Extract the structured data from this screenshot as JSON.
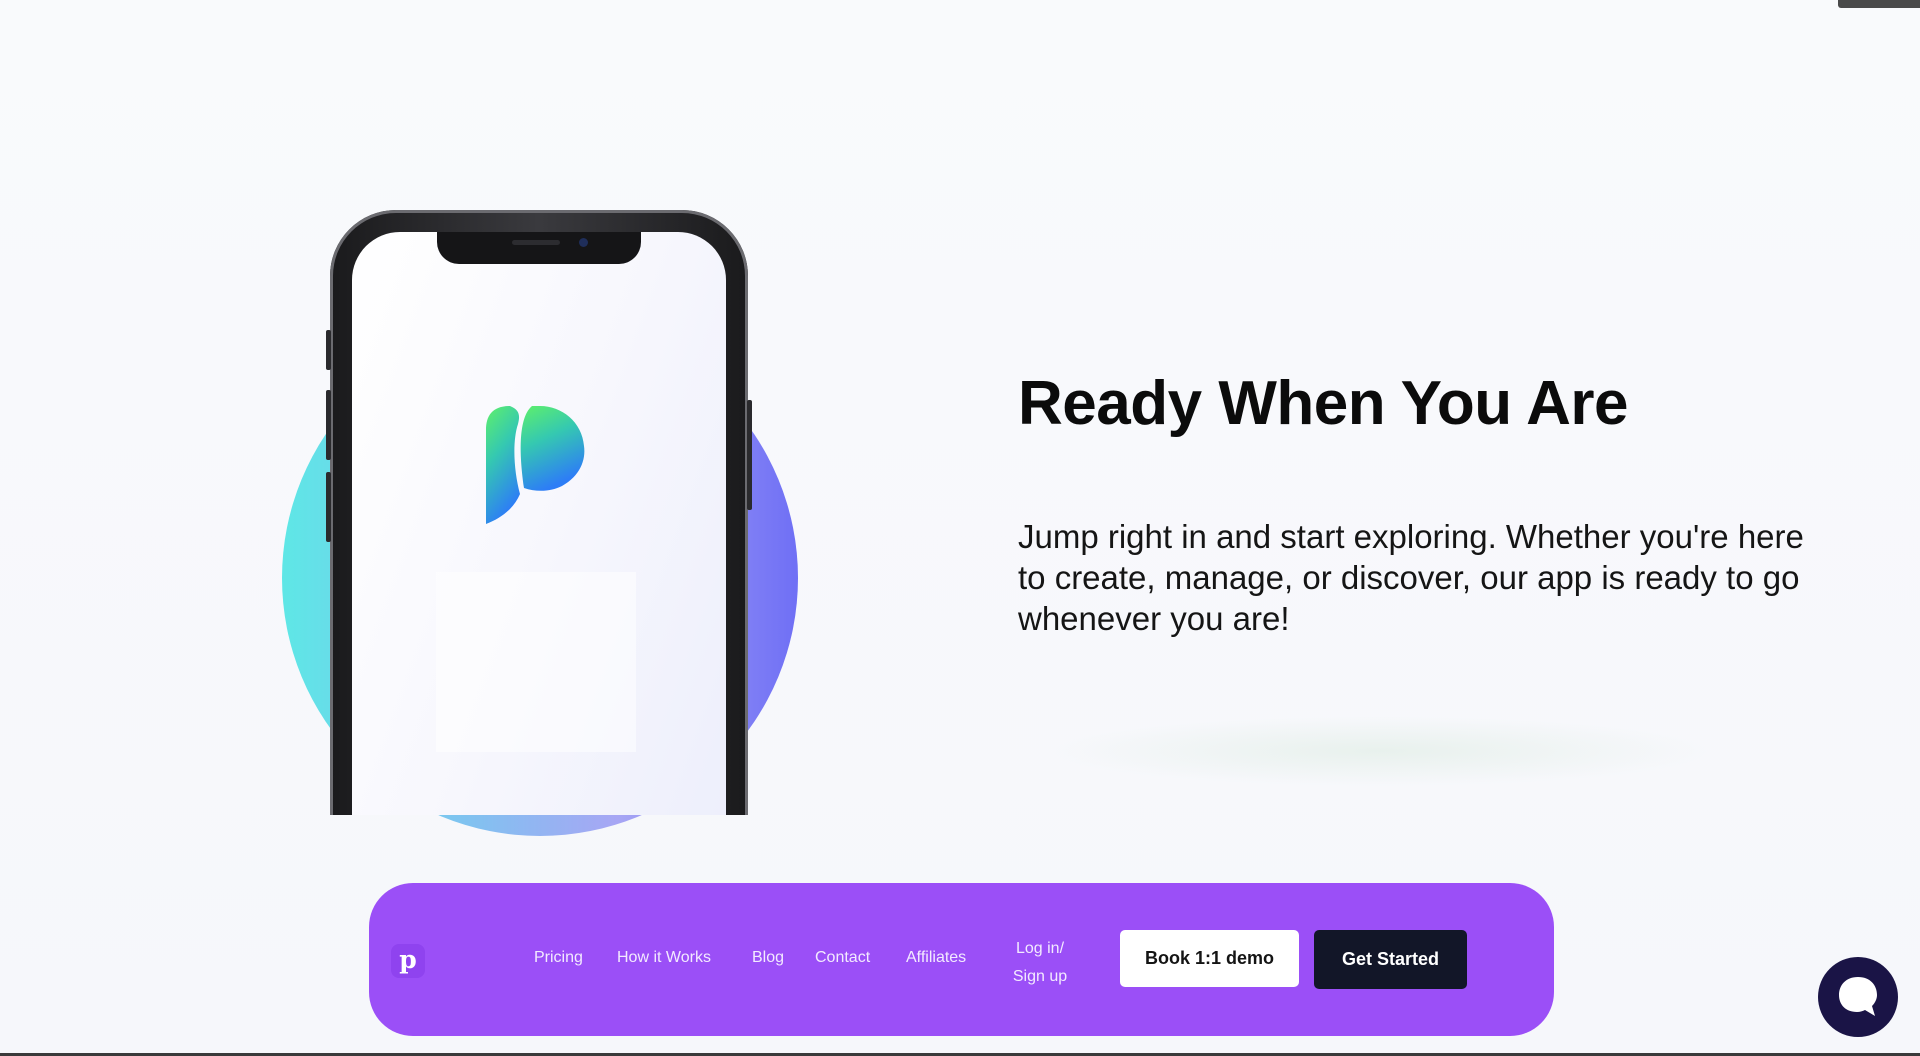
{
  "hero": {
    "title": "Ready When You Are",
    "description": "Jump right in and start exploring. Whether you're here to create, manage, or discover, our app is ready to go whenever you are!"
  },
  "navbar": {
    "logo_letter": "p",
    "links": [
      "Pricing",
      "How it Works",
      "Blog",
      "Contact",
      "Affiliates"
    ],
    "login_line1": "Log in/",
    "login_line2": "Sign up",
    "demo_button": "Book 1:1 demo",
    "start_button": "Get Started",
    "background_color": "#9b4ff7"
  },
  "icons": {
    "chat": "chat-bubble-icon",
    "app_logo": "p-logo-icon"
  },
  "colors": {
    "accent": "#9b4ff7",
    "dark_button": "#121628",
    "chat_widget": "#1a1446"
  }
}
